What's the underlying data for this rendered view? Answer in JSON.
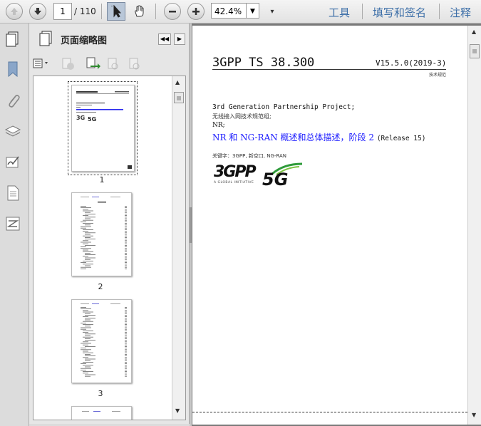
{
  "toolbar": {
    "page_current": "1",
    "page_total": "/ 110",
    "zoom": "42.4%",
    "menu_tools": "工具",
    "menu_sign": "填写和签名",
    "menu_comment": "注释"
  },
  "panel": {
    "title": "页面缩略图",
    "thumbnails": [
      "1",
      "2",
      "3"
    ]
  },
  "document": {
    "spec_title": "3GPP TS 38.300",
    "version": "V15.5.0(2019-3)",
    "spec_type": "技术规范",
    "org": "3rd Generation Partnership Project;",
    "group": "无线接入网技术规范组;",
    "nr": "NR;",
    "doc_title": "NR 和 NG-RAN 概述和总体描述，阶段 2",
    "release": "(Release 15)",
    "keywords": "关键字：3GPP, 新空口, NG-RAN",
    "logo_3gpp": "3GPP",
    "logo_tagline": "A GLOBAL INITIATIVE",
    "logo_5g": "5G"
  },
  "colors": {
    "accent": "#3d6fa8",
    "title_blue": "#1a1aff"
  },
  "icons": [
    "arrow-up-icon",
    "arrow-down-icon",
    "select-cursor-icon",
    "hand-icon",
    "zoom-out-icon",
    "zoom-in-icon",
    "chevron-down-icon",
    "pages-icon",
    "bookmark-icon",
    "attachment-icon",
    "layers-icon",
    "signature-icon",
    "document-icon",
    "compare-icon"
  ]
}
